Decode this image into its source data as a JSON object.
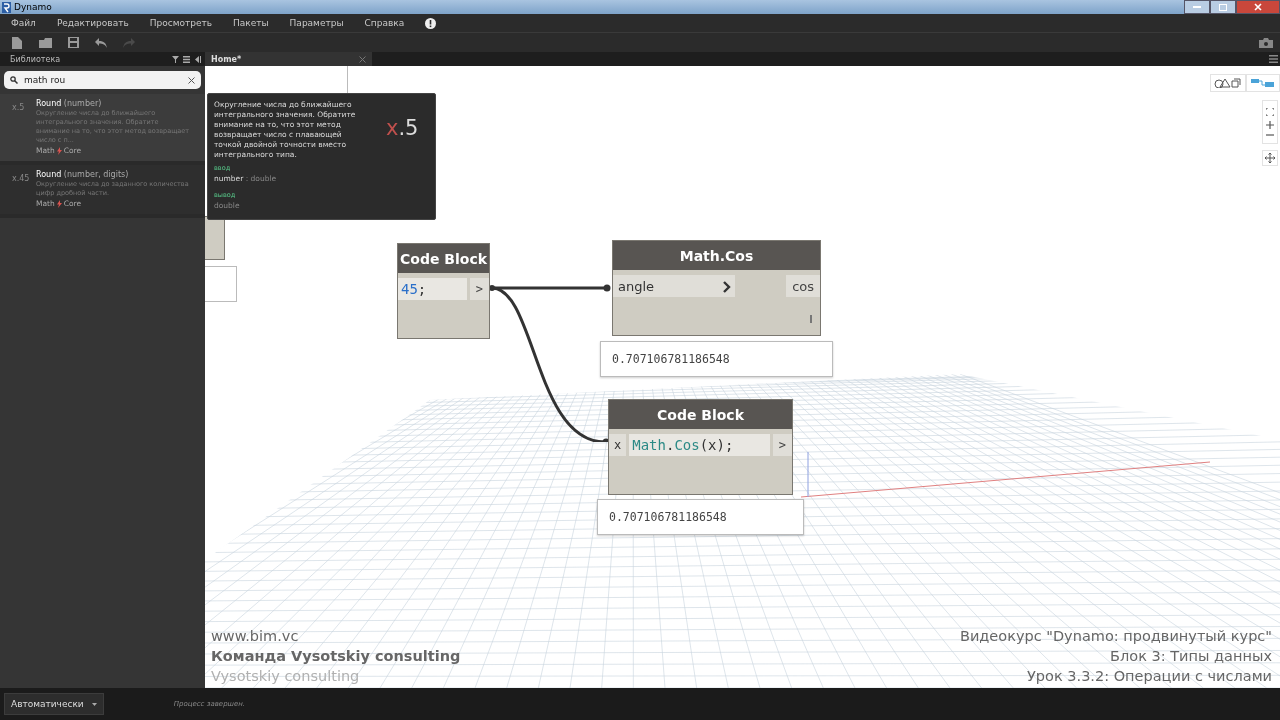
{
  "window": {
    "title": "Dynamo"
  },
  "menu": [
    {
      "label": "Файл"
    },
    {
      "label": "Редактировать"
    },
    {
      "label": "Просмотреть"
    },
    {
      "label": "Пакеты"
    },
    {
      "label": "Параметры"
    },
    {
      "label": "Справка"
    }
  ],
  "toolbar": [
    {
      "kind": "new",
      "disabled": false
    },
    {
      "kind": "open",
      "disabled": false
    },
    {
      "kind": "save",
      "disabled": false
    },
    {
      "kind": "undo",
      "disabled": false
    },
    {
      "kind": "redo",
      "disabled": true
    }
  ],
  "library": {
    "title": "Библиотека",
    "search": {
      "value": "math rou"
    },
    "results": [
      {
        "icon": "x.5",
        "name": "Round",
        "params": " (number)",
        "description": "Округление числа до ближайшего интегрального значения. Обратите внимание на то, что этот метод возвращает число с п...",
        "category": "Math",
        "source": "Core",
        "selected": true
      },
      {
        "icon": "x.45",
        "name": "Round",
        "params": " (number, digits)",
        "description": "Округление числа до заданного количества цифр дробной части.",
        "category": "Math",
        "source": "Core",
        "selected": false
      }
    ]
  },
  "tabs": [
    {
      "label": "Home*",
      "selected": true
    }
  ],
  "tooltip": {
    "description": "Округление числа до ближайшего интегрального значения. Обратите внимание на то, что этот метод возвращает число с плавающей точкой двойной точности вместо интегрального типа.",
    "icon_head": "x",
    "icon_tail": ".5",
    "input_label": "ввод",
    "input_name": "number",
    "input_type": " : double",
    "output_label": "вывод",
    "output_type": "double"
  },
  "nodes": [
    {
      "kind": "code",
      "title": "Code Block",
      "tokens": [
        {
          "text": "45",
          "kind": "number"
        },
        {
          "text": ";",
          "kind": "plain"
        }
      ],
      "output": ">"
    },
    {
      "kind": "function",
      "title": "Math.Cos",
      "input": "angle",
      "output": "cos",
      "preview": "0.707106781186548"
    },
    {
      "kind": "code",
      "title": "Code Block",
      "input": "x",
      "tokens": [
        {
          "text": "Math",
          "kind": "name"
        },
        {
          "text": ".",
          "kind": "plain"
        },
        {
          "text": "Cos",
          "kind": "name"
        },
        {
          "text": "(x);",
          "kind": "plain"
        }
      ],
      "output": ">",
      "preview": "0.707106781186548"
    }
  ],
  "captions": {
    "left": [
      {
        "text": "www.bim.vc",
        "kind": "plain"
      },
      {
        "text": "Команда Vysotskiy consulting",
        "kind": "bold"
      },
      {
        "text": "Vysotskiy consulting",
        "kind": "faint"
      }
    ],
    "right": [
      {
        "text": "Видеокурс \"Dynamo: продвинутый курс\"",
        "kind": "plain"
      },
      {
        "text": "Блок 3: Типы данных",
        "kind": "plain"
      },
      {
        "text": "Урок 3.3.2: Операции с числами",
        "kind": "plain"
      }
    ]
  },
  "status_bar": {
    "run_mode": "Автоматически",
    "message": "Процесс завершен."
  }
}
